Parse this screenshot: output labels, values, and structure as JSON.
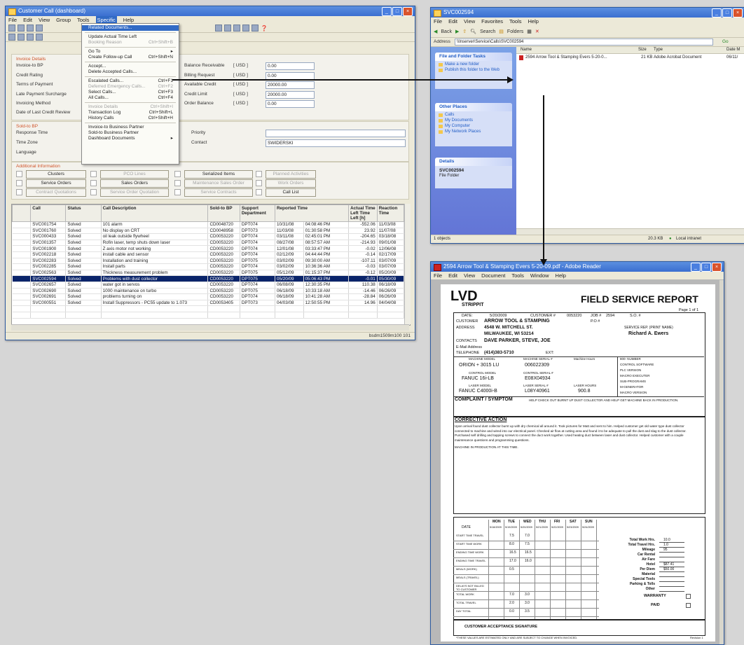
{
  "win1": {
    "title": "Customer Call (dashboard)",
    "menu": [
      "File",
      "Edit",
      "View",
      "Group",
      "Tools",
      "Specific",
      "Help"
    ],
    "invoice": {
      "heading": "Invoice Details",
      "labels": [
        "Invoice-to BP",
        "Credit Rating",
        "Terms of Payment",
        "Late Payment Surcharge",
        "Invoicing Method",
        "Date of Last Credit Review"
      ],
      "right_labels": [
        "Balance Receivable",
        "Billing Request",
        "Available Credit",
        "Credit Limit",
        "Order Balance"
      ],
      "currency": "[ USD ]",
      "right_values": [
        "0.00",
        "0.00",
        "20000.00",
        "20000.00",
        "0.00"
      ]
    },
    "sold": {
      "heading": "Sold-to BP",
      "labels": [
        "Response Time",
        "Time Zone",
        "Language"
      ],
      "priority_label": "Priority",
      "contact_label": "Contact",
      "contact_value": "SWIDERSKI"
    },
    "additional": {
      "heading": "Additional Information",
      "buttons": [
        "Clusters",
        "Service Orders",
        "Contract Quotations",
        "PCO Lines",
        "Sales Orders",
        "Service Order Quotation",
        "Serialized Items",
        "Maintenance Sales Order",
        "Service Contracts",
        "Planned Activities",
        "Work Orders",
        "Call List"
      ]
    },
    "table": {
      "headers": [
        "Call",
        "Status",
        "Call Description",
        "Sold-to BP",
        "Support Department",
        "Reported Time",
        "",
        "Actual Time Left Time Left [h]",
        "Reaction Time"
      ],
      "rows": [
        [
          "SVC001754",
          "Solved",
          "101 alarm",
          "CD0048720",
          "DPT074",
          "10/31/08",
          "04:08:46 PM",
          "-552.06",
          "11/03/08"
        ],
        [
          "SVC001760",
          "Solved",
          "No display on CRT",
          "CD0048958",
          "DPT073",
          "11/03/08",
          "01:30:58 PM",
          "23.92",
          "11/07/08"
        ],
        [
          "SVC000433",
          "Solved",
          "oil leak outside flywheel",
          "CD0053220",
          "DPT074",
          "03/11/08",
          "02:45:01 PM",
          "-204.65",
          "03/18/08"
        ],
        [
          "SVC001357",
          "Solved",
          "Rofin laser, temp shuts down laser",
          "CD0053220",
          "DPT074",
          "08/27/08",
          "08:57:57 AM",
          "-214.93",
          "09/01/08"
        ],
        [
          "SVC001900",
          "Solved",
          "Z axis motor not working",
          "CD0053220",
          "DPT074",
          "12/01/08",
          "03:33:47 PM",
          "-0.02",
          "12/06/08"
        ],
        [
          "SVC002218",
          "Solved",
          "install cable and sensor",
          "CD0053220",
          "DPT074",
          "02/12/09",
          "04:44:44 PM",
          "-0.14",
          "02/17/09"
        ],
        [
          "SVC002283",
          "Solved",
          "Installation and training",
          "CD0053220",
          "DPT075",
          "03/02/09",
          "09:30:00 AM",
          "-107.11",
          "03/07/09"
        ],
        [
          "SVC002285",
          "Solved",
          "Install parts",
          "CD0053220",
          "DPT074",
          "03/02/09",
          "10:36:36 AM",
          "-0.03",
          "03/07/09"
        ],
        [
          "SVC002563",
          "Solved",
          "Thickness measurement problem",
          "CD0053220",
          "DPT075",
          "05/12/09",
          "01:15:37 PM",
          "-0.12",
          "05/20/09"
        ],
        [
          "SVC002594",
          "Solved",
          "Problems with dust collector",
          "CD0053220",
          "DPT075",
          "05/20/09",
          "05:06:43 PM",
          "-0.01",
          "05/30/09"
        ],
        [
          "SVC002657",
          "Solved",
          "water got in servos",
          "CD0053220",
          "DPT074",
          "06/08/09",
          "12:30:35 PM",
          "110.38",
          "06/18/09"
        ],
        [
          "SVC002690",
          "Solved",
          "1000 maintenance on turbo",
          "CD0053220",
          "DPT075",
          "06/18/09",
          "10:33:18 AM",
          "-14.46",
          "06/26/09"
        ],
        [
          "SVC002691",
          "Solved",
          "problems turning on",
          "CD0053220",
          "DPT074",
          "06/18/09",
          "10:41:28 AM",
          "-28.84",
          "06/26/09"
        ],
        [
          "SVC000551",
          "Solved",
          "Install Suppressors - PC55 update to 1.073",
          "CD0053405",
          "DPT073",
          "04/03/08",
          "12:50:55 PM",
          "14.96",
          "04/04/08"
        ]
      ],
      "highlight_index": 9
    },
    "status": "bsdm1509m100   101"
  },
  "context_menu": {
    "items": [
      {
        "label": "Related Documents...",
        "hl": true
      },
      {
        "sep": true
      },
      {
        "label": "Update Actual Time Left"
      },
      {
        "label": "Booking Reason",
        "sc": "Ctrl+Shift+B",
        "dis": true
      },
      {
        "sep": true
      },
      {
        "label": "Go To",
        "sub": true
      },
      {
        "label": "Create Follow-up Call",
        "sc": "Ctrl+Shift+N"
      },
      {
        "sep": true
      },
      {
        "label": "Accept..."
      },
      {
        "label": "Delete Accepted Calls..."
      },
      {
        "sep": true
      },
      {
        "label": "Escalated Calls...",
        "sc": "Ctrl+F1"
      },
      {
        "label": "Deferred Emergency Calls...",
        "sc": "Ctrl+F2",
        "dis": true
      },
      {
        "label": "Select Calls...",
        "sc": "Ctrl+F3"
      },
      {
        "label": "All Calls...",
        "sc": "Ctrl+F4"
      },
      {
        "sep": true
      },
      {
        "label": "Invoice Details",
        "sc": "Ctrl+Shift+I",
        "dis": true
      },
      {
        "label": "Transaction Log",
        "sc": "Ctrl+Shift+L"
      },
      {
        "label": "History Calls",
        "sc": "Ctrl+Shift+H"
      },
      {
        "sep": true
      },
      {
        "label": "Invoice-to Business Partner"
      },
      {
        "label": "Sold-to Business Partner"
      },
      {
        "label": "Dashboard Documents",
        "sub": true
      }
    ]
  },
  "win2": {
    "title": "SVC002594",
    "menu": [
      "File",
      "Edit",
      "View",
      "Favorites",
      "Tools",
      "Help"
    ],
    "toolbar": [
      "Back",
      "Search",
      "Folders"
    ],
    "address_label": "Address",
    "address": "\\\\lnserver\\Service\\Calls\\SVC002594",
    "go": "Go",
    "columns": [
      "Name",
      "Size",
      "Type",
      "Date M"
    ],
    "file": {
      "name": "2594 Arrow Tool & Stamping Evers 5-20-0...",
      "size": "21 KB",
      "type": "Adobe Acrobat Document",
      "date": "06/11/"
    },
    "tasks": {
      "head": "File and Folder Tasks",
      "items": [
        "Make a new folder",
        "Publish this folder to the Web"
      ]
    },
    "places": {
      "head": "Other Places",
      "items": [
        "Calls",
        "My Documents",
        "My Computer",
        "My Network Places"
      ]
    },
    "details": {
      "head": "Details",
      "name": "SVC002594",
      "type": "File Folder"
    },
    "status_left": "1 objects",
    "status_mid": "20.3 KB",
    "status_right": "Local intranet"
  },
  "win3": {
    "title": "2594 Arrow Tool & Stamping Evers 5-20-09.pdf - Adobe Reader",
    "menu": [
      "File",
      "Edit",
      "View",
      "Document",
      "Tools",
      "Window",
      "Help"
    ],
    "report": {
      "logo": "LVD",
      "logo_sub": "STRIPPIT",
      "title": "FIELD SERVICE REPORT",
      "page": "Page 1 of 1",
      "date_label": "DATE:",
      "date": "5/20/2009",
      "customer_no_label": "CUSTOMER #",
      "customer_no": "0053220",
      "job_label": "JOB #",
      "job": "2594",
      "so_label": "S.O. #",
      "customer_label": "CUSTOMER",
      "customer": "ARROW TOOL & STAMPING",
      "po_label": "P.O #",
      "address_label": "ADDRESS",
      "address1": "4548 W. MITCHELL ST.",
      "address2": "MILWAUKEE, WI 53214",
      "rep_label": "SERVICE REP.   (PRINT NAME)",
      "rep": "Richard A. Ewers",
      "contacts_label": "CONTACTS",
      "contacts": "DAVE PARKER, STEVE, JOE",
      "email_label": "E-Mail Address",
      "tel_label": "TELEPHONE",
      "tel": "(414)383-5710",
      "ext": "EXT:",
      "machine_model_h": "MACHINE MODEL",
      "machine_serial_h": "MACHINE SERIAL #",
      "machine_hours_h": "Machine Hours",
      "model": "ORION + 3015 LU",
      "serial": "006022309",
      "control_model_h": "CONTROL MODEL",
      "control_serial_h": "CONTROL SERIAL #",
      "control_model": "FANUC 16i-LB",
      "control_serial": "E08X04934",
      "laser_model_h": "LASER MODEL",
      "laser_serial_h": "LASER SERIAL #",
      "laser_hours_h": "LASER HOURS",
      "laser_model": "FANUC C4000i-B",
      "laser_serial": "L08Y40961",
      "laser_hours": "900.8",
      "right_col": [
        "800- NUMBER",
        "CONTROL SOFTWARE",
        "PLC VERSION",
        "MACRO EXECUTER",
        "SUB-PROGRAMS",
        "M-GENERATOR",
        "MACRO VERSION"
      ],
      "complaint_label": "COMPLAINT / SYMPTOM",
      "complaint": "HELP CHECK OUT BURNT UP DUST COLLECTOR AND HELP GET MACHINE BACK IN PRODUCTION.",
      "corrective_label": "CORRECTIVE ACTION",
      "corrective": "Upon arrival found dust collector burnt up with dry chemical all around it. Took pictures for Matt and sent to him. Helped customer get old water type dust collector connected to machine and wired into our electrical panel. Checked air flow at cutting area and found it to be adequate to pull the dust and slag to the dust collector. Purchased self drilling and tapping screws to connect the duct work together. Used heating duct between laser and dust collector. Helped customer with a couple maintenance questions and programming questions.",
      "corrective2": "MACHINE IN PRODUCTION AT THIS TIME.",
      "days": [
        "MON",
        "TUE",
        "WED",
        "THU",
        "FRI",
        "SAT",
        "SUN"
      ],
      "dates": [
        "5/18/2009",
        "5/19/2009",
        "5/20/2009",
        "5/21/2009",
        "5/22/2009",
        "5/23/2009",
        "5/24/2009"
      ],
      "date_row": "DATE",
      "time_rows": [
        {
          "label": "START TIME TRAVEL",
          "v": [
            "",
            "7.5",
            "7.0"
          ]
        },
        {
          "label": "START TIME WORK",
          "v": [
            "",
            "8.0",
            "7.5"
          ]
        },
        {
          "label": "ENDING TIME WORK",
          "v": [
            "",
            "16.5",
            "16.5"
          ]
        },
        {
          "label": "ENDING TIME TRAVEL",
          "v": [
            "",
            "17.0",
            "16.0"
          ]
        },
        {
          "label": "MEALS (WORK)",
          "v": [
            "",
            "0.5",
            ""
          ]
        },
        {
          "label": "MEALS (TRAVEL)",
          "v": [
            "",
            "",
            ""
          ]
        },
        {
          "label": "DELAYS NOT BILLED TO CUSTOMER",
          "v": [
            "",
            "",
            ""
          ]
        },
        {
          "label": "TOTAL WORK",
          "v": [
            "",
            "7.0",
            "3.0"
          ]
        },
        {
          "label": "TOTAL TRAVEL",
          "v": [
            "",
            "2.0",
            "3.0"
          ]
        },
        {
          "label": "DAY TOTAL",
          "v": [
            "",
            "0.0",
            "3.5"
          ]
        }
      ],
      "totals": [
        {
          "label": "Total Work Hrs.",
          "v": "10.0"
        },
        {
          "label": "Total Travel Hrs.",
          "v": "1.0"
        },
        {
          "label": "Mileage",
          "v": "95"
        },
        {
          "label": "Car Rental",
          "v": ""
        },
        {
          "label": "Air Fare",
          "v": ""
        },
        {
          "label": "Hotel",
          "v": "$87.41"
        },
        {
          "label": "Per Diem",
          "v": "$50.00"
        },
        {
          "label": "Material",
          "v": ""
        },
        {
          "label": "Special Tools",
          "v": ""
        },
        {
          "label": "Parking & Tolls",
          "v": ""
        },
        {
          "label": "Other",
          "v": ""
        }
      ],
      "warranty_label": "WARRANTY",
      "paid_label": "PAID",
      "signature_label": "CUSTOMER ACCEPTANCE SIGNATURE",
      "footer": "*THESE VALUES ARE ESTIMATED ONLY AND ARE SUBJECT TO CHANGE WHEN INVOICED.",
      "revision": "Revision 1"
    }
  }
}
